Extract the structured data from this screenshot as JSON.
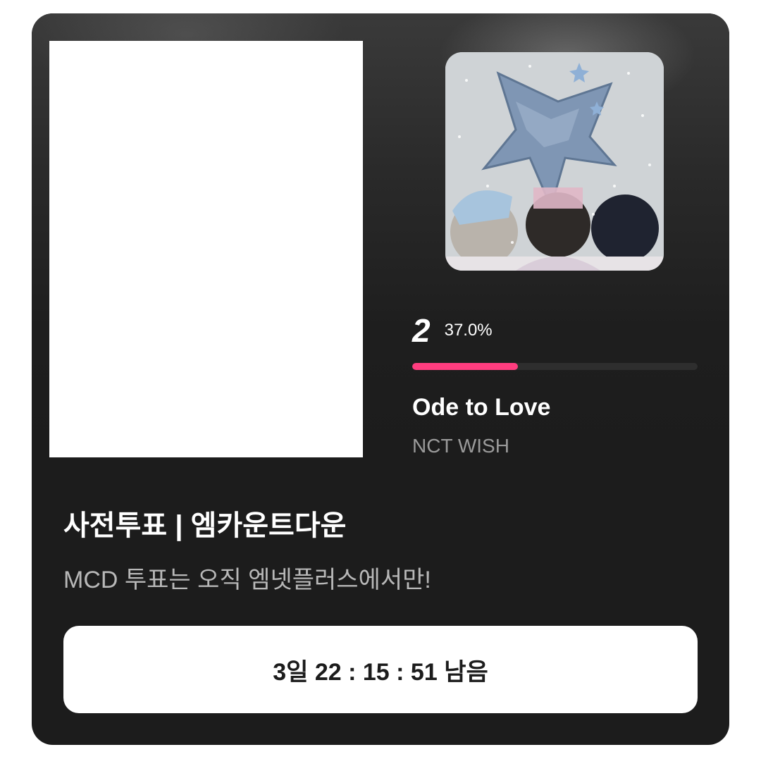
{
  "vote_card": {
    "rank": "2",
    "percentage": "37.0%",
    "progress_fraction": 0.37,
    "progress_color": "#ff3d7f",
    "song_title": "Ode to Love",
    "artist": "NCT WISH",
    "event_title": "사전투표 | 엠카운트다운",
    "event_subtitle": "MCD 투표는 오직 엠넷플러스에서만!",
    "countdown_label": "3일 22 : 15 : 51 남음"
  }
}
